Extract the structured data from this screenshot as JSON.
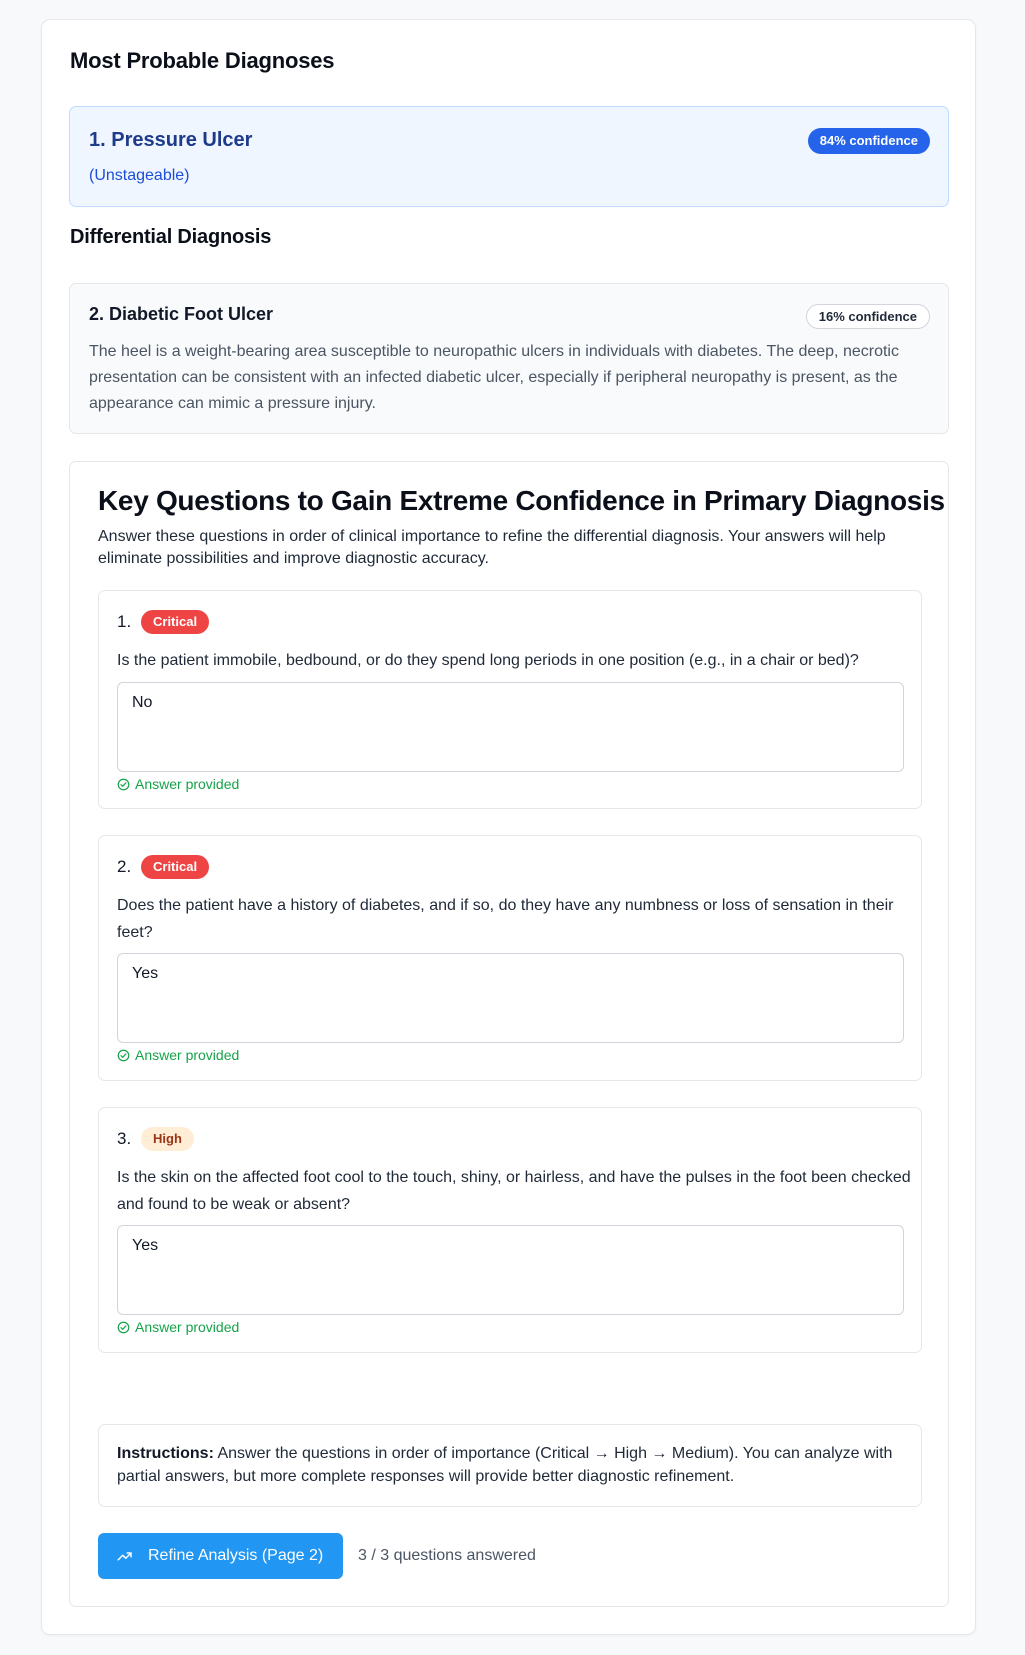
{
  "diagnoses": {
    "title": "Most Probable Diagnoses",
    "primary": {
      "name": "1. Pressure Ulcer",
      "subtitle": "(Unstageable)",
      "confidence": "84% confidence"
    }
  },
  "differential": {
    "title": "Differential Diagnosis",
    "items": [
      {
        "name": "2. Diabetic Foot Ulcer",
        "confidence": "16% confidence",
        "description": "The heel is a weight-bearing area susceptible to neuropathic ulcers in individuals with diabetes. The deep, necrotic presentation can be consistent with an infected diabetic ulcer, especially if peripheral neuropathy is present, as the appearance can mimic a pressure injury."
      }
    ]
  },
  "key_questions": {
    "heading": "Key Questions to Gain Extreme Confidence in Primary Diagnosis",
    "intro": "Answer these questions in order of clinical importance to refine the differential diagnosis. Your answers will help eliminate possibilities and improve diagnostic accuracy.",
    "questions": [
      {
        "number": "1.",
        "priority": "Critical",
        "text": "Is the patient immobile, bedbound, or do they spend long periods in one position (e.g., in a chair or bed)?",
        "answer": "No",
        "status": "Answer provided"
      },
      {
        "number": "2.",
        "priority": "Critical",
        "text": "Does the patient have a history of diabetes, and if so, do they have any numbness or loss of sensation in their feet?",
        "answer": "Yes",
        "status": "Answer provided"
      },
      {
        "number": "3.",
        "priority": "High",
        "text": "Is the skin on the affected foot cool to the touch, shiny, or hairless, and have the pulses in the foot been checked and found to be weak or absent?",
        "answer": "Yes",
        "status": "Answer provided"
      }
    ],
    "instructions_label": "Instructions:",
    "instructions_text": " Answer the questions in order of importance (Critical → High → Medium). You can analyze with partial answers, but more complete responses will provide better diagnostic refinement.",
    "refine_button": "Refine Analysis (Page 2)",
    "progress": "3 / 3 questions answered"
  },
  "colors": {
    "primary_blue": "#2563eb",
    "button_blue": "#2196f3",
    "critical_red": "#ef4444",
    "high_orange_bg": "#ffedd5",
    "success_green": "#16a34a"
  },
  "icons": {
    "status": "check-circle-icon",
    "refine": "trending-up-icon"
  }
}
